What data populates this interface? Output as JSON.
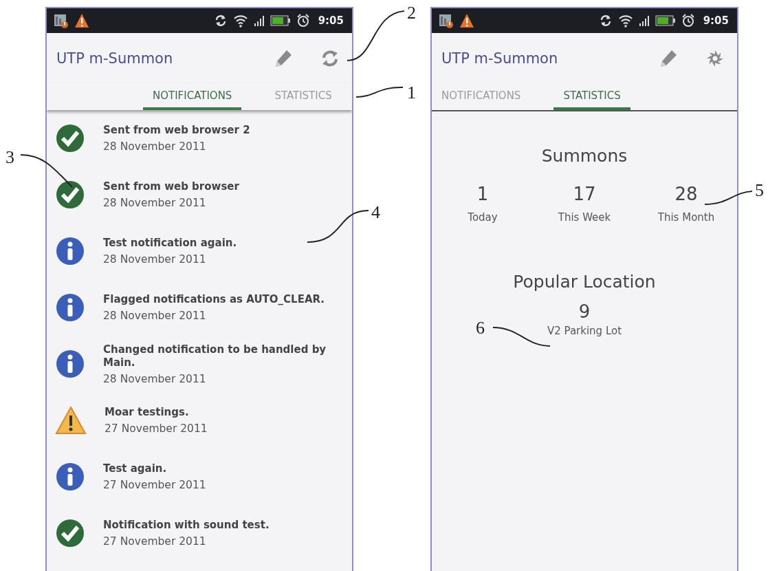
{
  "callouts": [
    "1",
    "2",
    "3",
    "4",
    "5",
    "6"
  ],
  "screens": [
    {
      "status_bar": {
        "time": "9:05"
      },
      "app_bar": {
        "title": "UTP m-Summon",
        "actions": [
          {
            "kind": "edit"
          },
          {
            "kind": "refresh"
          }
        ]
      },
      "tabs": [
        {
          "label": "NOTIFICATIONS",
          "selected": true
        },
        {
          "label": "STATISTICS",
          "selected": false
        }
      ],
      "content": {
        "kind": "notifications",
        "items": [
          {
            "kind": "success",
            "title": "Sent from web browser 2",
            "date": "28 November 2011"
          },
          {
            "kind": "success",
            "title": "Sent from web browser",
            "date": "28 November 2011"
          },
          {
            "kind": "info",
            "title": "Test notification again.",
            "date": "28 November 2011"
          },
          {
            "kind": "info",
            "title": "Flagged notifications as AUTO_CLEAR.",
            "date": "28 November 2011"
          },
          {
            "kind": "info",
            "title": "Changed notification to be handled by Main.",
            "date": "28 November 2011"
          },
          {
            "kind": "warning",
            "title": "Moar testings.",
            "date": "27 November 2011"
          },
          {
            "kind": "info",
            "title": "Test again.",
            "date": "27 November 2011"
          },
          {
            "kind": "success",
            "title": "Notification with sound test.",
            "date": "27 November 2011"
          }
        ]
      }
    },
    {
      "status_bar": {
        "time": "9:05"
      },
      "app_bar": {
        "title": "UTP m-Summon",
        "actions": [
          {
            "kind": "edit"
          },
          {
            "kind": "busy"
          }
        ]
      },
      "tabs": [
        {
          "label": "NOTIFICATIONS",
          "selected": false
        },
        {
          "label": "STATISTICS",
          "selected": true
        }
      ],
      "content": {
        "kind": "statistics",
        "heading": "Summons",
        "counts": [
          {
            "value": "1",
            "label": "Today"
          },
          {
            "value": "17",
            "label": "This Week"
          },
          {
            "value": "28",
            "label": "This Month"
          }
        ],
        "location_heading": "Popular Location",
        "location": {
          "value": "9",
          "label": "V2 Parking Lot"
        }
      }
    }
  ]
}
